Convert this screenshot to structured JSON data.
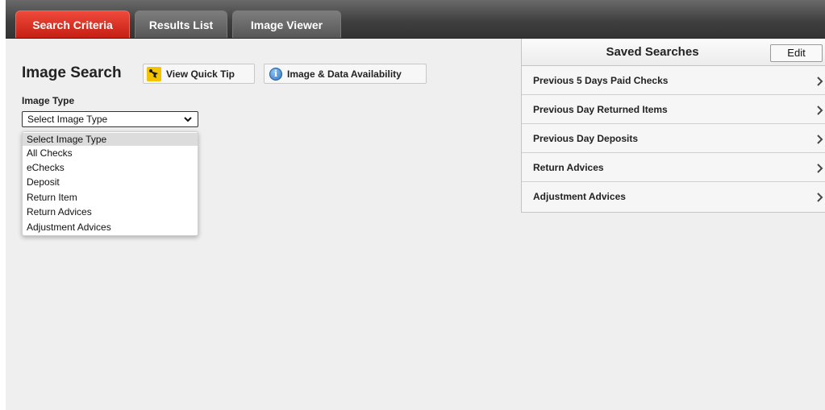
{
  "tabs": [
    {
      "label": "Search Criteria",
      "active": true
    },
    {
      "label": "Results List",
      "active": false
    },
    {
      "label": "Image Viewer",
      "active": false
    }
  ],
  "search": {
    "title": "Image Search",
    "quick_tip_label": "View Quick Tip",
    "quick_tip_icon": "tip-icon",
    "availability_label": "Image & Data Availability",
    "availability_icon": "info-icon",
    "info_glyph": "i"
  },
  "image_type": {
    "label": "Image Type",
    "selected": "Select Image Type",
    "options": [
      "Select Image Type",
      "All Checks",
      "eChecks",
      "Deposit",
      "Return Item",
      "Return Advices",
      "Adjustment Advices"
    ]
  },
  "saved_searches": {
    "title": "Saved Searches",
    "edit_label": "Edit",
    "items": [
      "Previous 5 Days Paid Checks",
      "Previous Day Returned Items",
      "Previous Day Deposits",
      "Return Advices",
      "Adjustment Advices"
    ]
  },
  "colors": {
    "active_tab": "#d9291c",
    "tab_bar": "#444444",
    "panel_bg": "#efefef",
    "tip_icon": "#f4c300",
    "info_icon": "#2f78c8"
  }
}
